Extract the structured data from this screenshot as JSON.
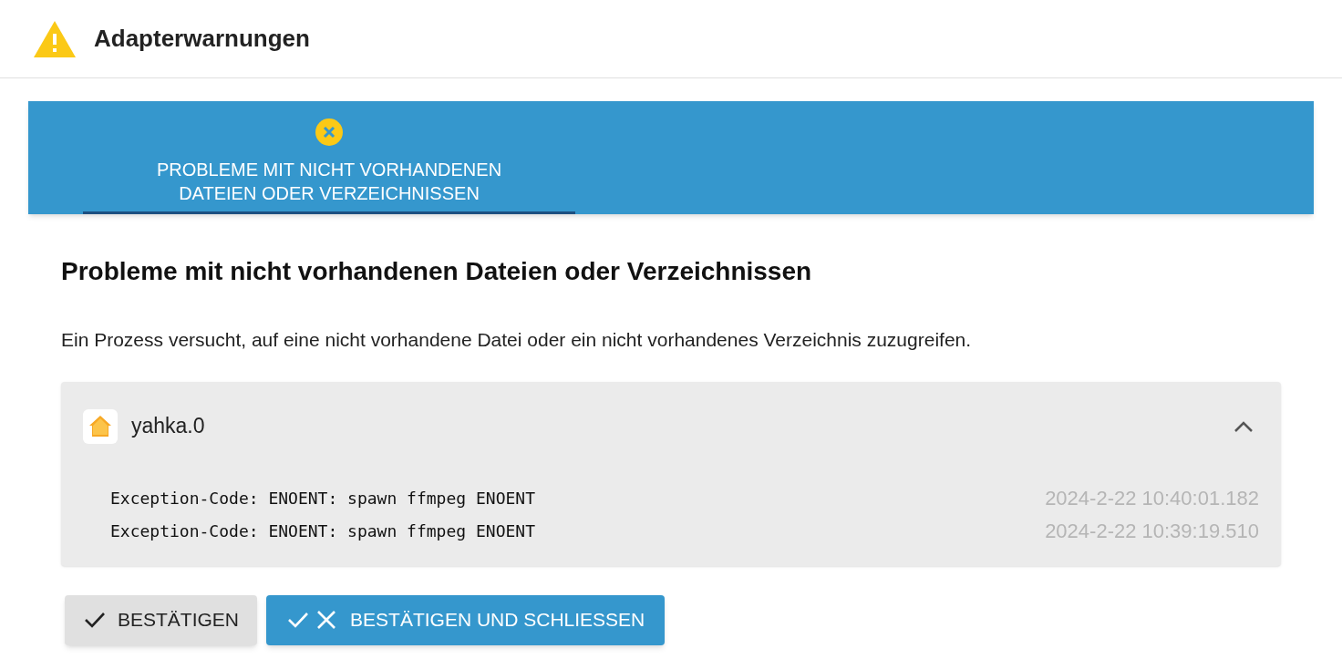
{
  "header": {
    "title": "Adapterwarnungen"
  },
  "tabs": [
    {
      "label": "PROBLEME MIT NICHT VORHANDENEN DATEIEN ODER VERZEICHNISSEN",
      "selected": true
    }
  ],
  "section": {
    "heading": "Probleme mit nicht vorhandenen Dateien oder Verzeichnissen",
    "description": "Ein Prozess versucht, auf eine nicht vorhandene Datei oder ein nicht vorhandenes Verzeichnis zuzugreifen."
  },
  "adapters": [
    {
      "name": "yahka.0",
      "expanded": true,
      "entries": [
        {
          "message": "Exception-Code: ENOENT: spawn ffmpeg ENOENT",
          "time": "2024-2-22 10:40:01.182"
        },
        {
          "message": "Exception-Code: ENOENT: spawn ffmpeg ENOENT",
          "time": "2024-2-22 10:39:19.510"
        }
      ]
    }
  ],
  "buttons": [
    {
      "label": "BESTÄTIGEN",
      "kind": "secondary"
    },
    {
      "label": "BESTÄTIGEN UND SCHLIESSEN",
      "kind": "primary"
    }
  ]
}
